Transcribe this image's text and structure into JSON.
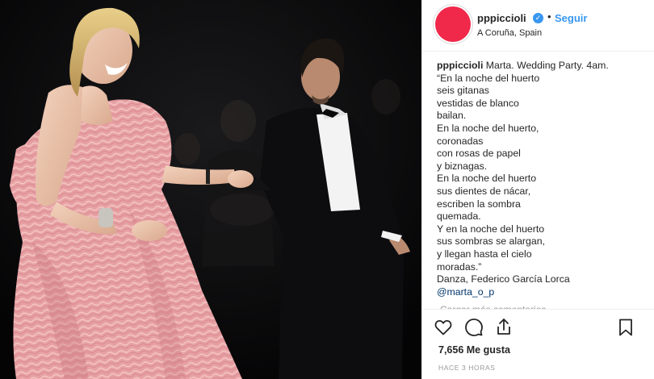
{
  "post": {
    "image_alt": "",
    "author": {
      "username": "pppiccioli",
      "verified_mark": "✓",
      "separator": "•",
      "follow_label": "Seguir",
      "location": "A Coruña, Spain",
      "avatar_color": "#f0294b"
    },
    "caption": {
      "username": "pppiccioli",
      "first_line": " Marta. Wedding Party. 4am.",
      "lines": [
        "“En la noche del huerto",
        "seis gitanas",
        "vestidas de blanco",
        "bailan.",
        "En la noche del huerto,",
        "coronadas",
        "con rosas de papel",
        "y biznagas.",
        "En la noche del huerto",
        "sus dientes de nácar,",
        "escriben la sombra",
        "quemada.",
        "Y en la noche del huerto",
        "sus sombras se alargan,",
        "y llegan hasta el cielo",
        "moradas.”",
        "Danza, Federico García Lorca"
      ],
      "mention": "@marta_o_p"
    },
    "comments": {
      "load_more_label": "Cargar más comentarios"
    },
    "actions": {
      "like_icon": "heart-icon",
      "comment_icon": "comment-icon",
      "share_icon": "share-icon",
      "save_icon": "bookmark-icon"
    },
    "likes_label": "7,656 Me gusta",
    "time_label": "HACE 3 HORAS"
  },
  "colors": {
    "link_blue": "#3897f0",
    "mention_blue": "#003569",
    "text": "#262626",
    "muted": "#999999",
    "divider": "#efefef",
    "dress_pink": "#e49a9e"
  }
}
